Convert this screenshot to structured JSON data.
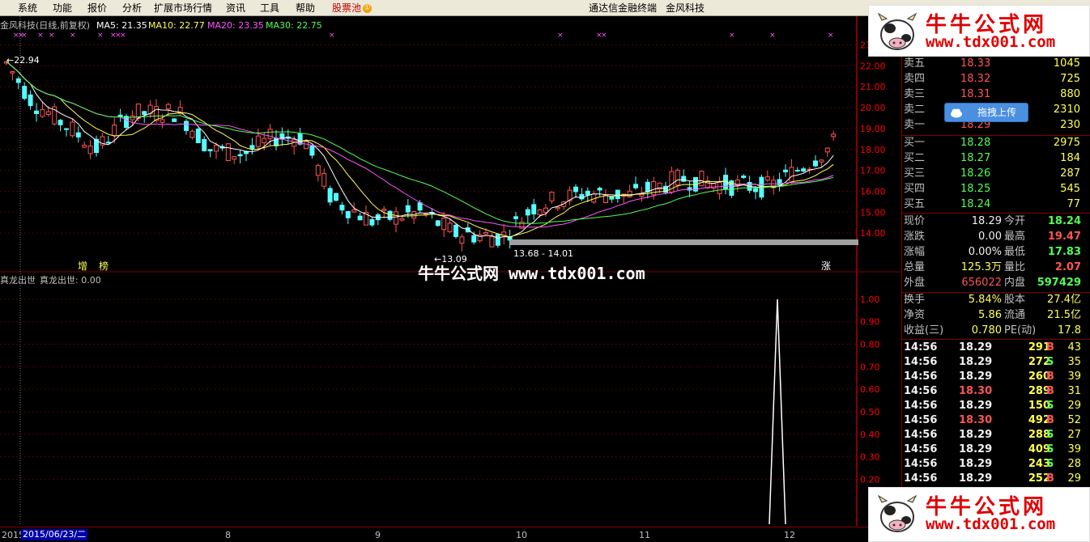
{
  "menu": {
    "items": [
      "系统",
      "功能",
      "报价",
      "分析",
      "扩展市场行情",
      "资讯",
      "工具",
      "帮助"
    ],
    "pool": "股票池",
    "pool_badge": "①",
    "center_title": "通达信金融终端",
    "company": "金风科技"
  },
  "chart": {
    "title": "金风科技(日线,前复权)",
    "ma5": "MA5: 21.35",
    "ma10": "MA10: 22.77",
    "ma20": "MA20: 23.35",
    "ma30": "MA30: 22.75",
    "high_label": "22.94",
    "low_label": "13.09",
    "range_label": "13.68 - 14.01",
    "marker_zeng": "增",
    "marker_bang": "榜",
    "marker_zhang": "涨",
    "indicator_title": "真龙出世",
    "indicator_value": "真龙出世: 0.00",
    "colors": {
      "up": "#ff5454",
      "down": "#54ffff",
      "ma5": "#ffffff",
      "ma10": "#ffff54",
      "ma20": "#ff54ff",
      "ma30": "#54ff54",
      "axis": "#ff0000"
    }
  },
  "price_axis": [
    "23.00",
    "22.00",
    "21.00",
    "20.00",
    "19.00",
    "18.00",
    "17.00",
    "16.00",
    "15.00",
    "14.00"
  ],
  "indicator_axis": [
    "1.00",
    "0.90",
    "0.80",
    "0.70",
    "0.60",
    "0.50",
    "0.40",
    "0.30",
    "0.20"
  ],
  "date_axis": {
    "start": "2015",
    "cursor": "2015/06/23/二",
    "months": [
      "8",
      "9",
      "10",
      "11",
      "12"
    ]
  },
  "chart_data": {
    "type": "candlestick",
    "price_range": [
      13.0,
      23.6
    ],
    "indicator_range": [
      0.0,
      1.05
    ],
    "indicator_peak": 1.0
  },
  "quote": {
    "sell": [
      {
        "label": "卖五",
        "price": "18.33",
        "vol": "1045"
      },
      {
        "label": "卖四",
        "price": "18.32",
        "vol": "725"
      },
      {
        "label": "卖三",
        "price": "18.31",
        "vol": "880"
      },
      {
        "label": "卖二",
        "price": "",
        "vol": "2310"
      },
      {
        "label": "卖一",
        "price": "18.29",
        "vol": "230"
      }
    ],
    "buy": [
      {
        "label": "买一",
        "price": "18.28",
        "vol": "2975"
      },
      {
        "label": "买二",
        "price": "18.27",
        "vol": "184"
      },
      {
        "label": "买三",
        "price": "18.26",
        "vol": "287"
      },
      {
        "label": "买四",
        "price": "18.25",
        "vol": "545"
      },
      {
        "label": "买五",
        "price": "18.24",
        "vol": "77"
      }
    ],
    "stats": [
      {
        "l1": "现价",
        "v1": "18.29",
        "l2": "今开",
        "v2": "18.24"
      },
      {
        "l1": "涨跌",
        "v1": "0.00",
        "l2": "最高",
        "v2": "19.47"
      },
      {
        "l1": "涨幅",
        "v1": "0.00%",
        "l2": "最低",
        "v2": "17.83"
      },
      {
        "l1": "总量",
        "v1": "125.3万",
        "l2": "量比",
        "v2": "2.07"
      },
      {
        "l1": "外盘",
        "v1": "656022",
        "l2": "内盘",
        "v2": "597429"
      }
    ],
    "stats2": [
      {
        "l1": "换手",
        "v1": "5.84%",
        "l2": "股本",
        "v2": "27.4亿"
      },
      {
        "l1": "净资",
        "v1": "5.86",
        "l2": "流通",
        "v2": "21.5亿"
      },
      {
        "l1": "收益(三)",
        "v1": "0.780",
        "l2": "PE(动)",
        "v2": "17.8"
      }
    ],
    "ticks": [
      {
        "t": "14:56",
        "p": "18.29",
        "v": "291",
        "s": "B",
        "n": "43"
      },
      {
        "t": "14:56",
        "p": "18.29",
        "v": "272",
        "s": "S",
        "n": "35"
      },
      {
        "t": "14:56",
        "p": "18.29",
        "v": "260",
        "s": "B",
        "n": "39"
      },
      {
        "t": "14:56",
        "p": "18.30",
        "v": "289",
        "s": "B",
        "n": "31"
      },
      {
        "t": "14:56",
        "p": "18.29",
        "v": "150",
        "s": "S",
        "n": "29"
      },
      {
        "t": "14:56",
        "p": "18.30",
        "v": "492",
        "s": "B",
        "n": "52"
      },
      {
        "t": "14:56",
        "p": "18.29",
        "v": "288",
        "s": "S",
        "n": "27"
      },
      {
        "t": "14:56",
        "p": "18.29",
        "v": "409",
        "s": "S",
        "n": "39"
      },
      {
        "t": "14:56",
        "p": "18.29",
        "v": "243",
        "s": "S",
        "n": "28"
      },
      {
        "t": "14:56",
        "p": "18.29",
        "v": "252",
        "s": "B",
        "n": "29"
      }
    ]
  },
  "upload_button": "拖拽上传",
  "banner": {
    "title": "牛牛公式网",
    "url": "www.tdx001.com"
  },
  "watermark": "牛牛公式网 www.tdx001.com"
}
